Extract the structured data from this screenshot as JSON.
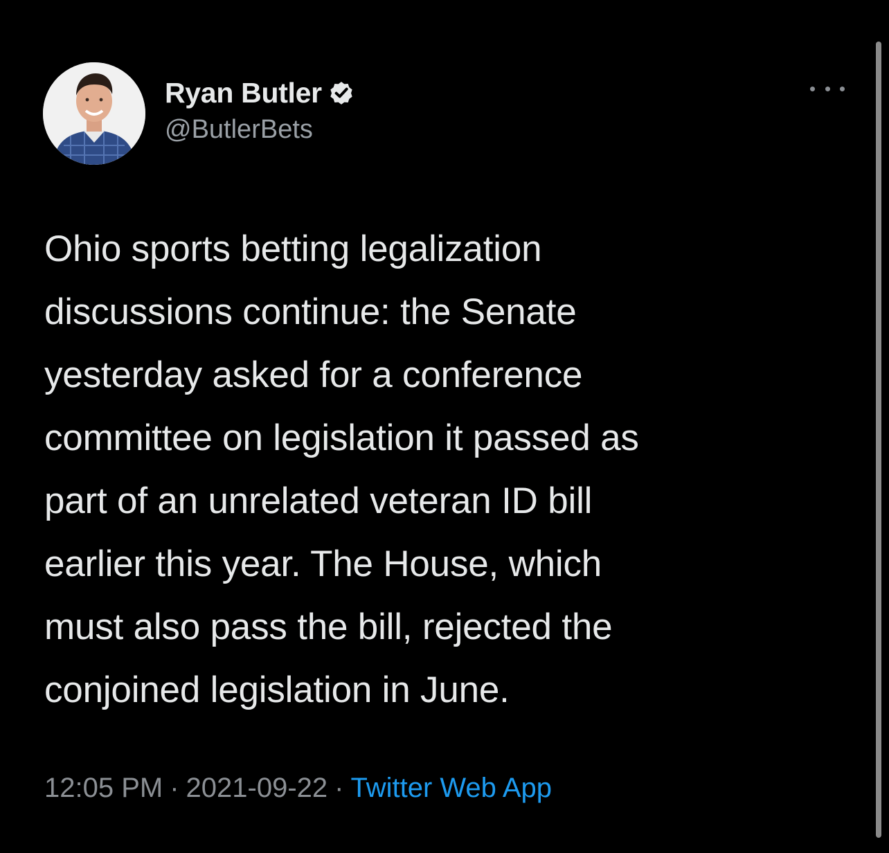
{
  "author": {
    "display_name": "Ryan Butler",
    "handle": "@ButlerBets"
  },
  "tweet": {
    "lines": [
      "Ohio sports betting legalization",
      "discussions continue: the Senate",
      "yesterday asked for a conference",
      "committee on legislation it passed as",
      "part of an unrelated veteran ID bill",
      "earlier this year. The House, which",
      "must also pass the bill, rejected the",
      "conjoined legislation in June."
    ]
  },
  "meta": {
    "time": "12:05 PM",
    "separator": "·",
    "date": "2021-09-22",
    "source": "Twitter Web App"
  },
  "icons": {
    "verified": "verified-badge-icon",
    "more": "more-options-icon"
  },
  "colors": {
    "background": "#000000",
    "text": "#e7e9ea",
    "muted": "#8b8f94",
    "accent": "#1d9bf0"
  }
}
